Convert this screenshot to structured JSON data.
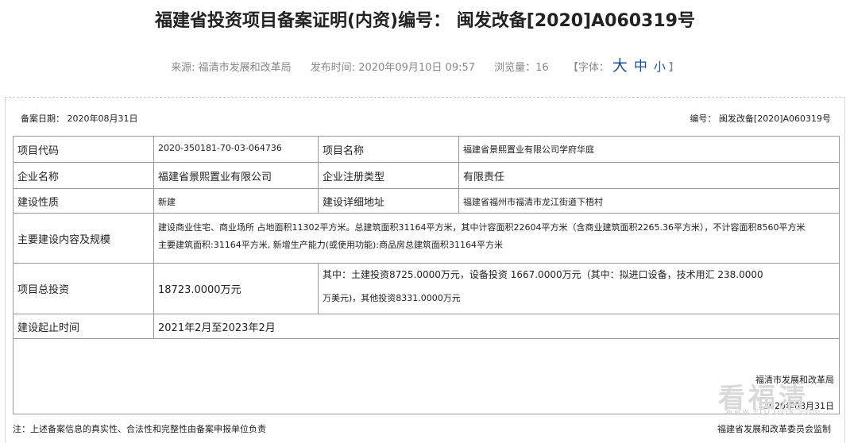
{
  "title": "福建省投资项目备案证明(内资)编号： 闽发改备[2020]A060319号",
  "meta": {
    "source": "来源: 福清市发展和改革局",
    "published": "发布时间: 2020年09月10日 09:57",
    "views": "浏览量：16",
    "font_switch_label": "【字体：",
    "font_big": "大",
    "font_mid": "中",
    "font_small": "小",
    "font_switch_end": "】"
  },
  "record": {
    "date": "备案日期： 2020年08月31日",
    "number": "编号： 闽发改备[2020]A060319号"
  },
  "rows": {
    "code_label": "项目代码",
    "code_value": "2020-350181-70-03-064736",
    "name_label": "项目名称",
    "name_value": "福建省景熙置业有限公司学府华庭",
    "company_label": "企业名称",
    "company_value": "福建省景熙置业有限公司",
    "type_label": "企业注册类型",
    "type_value": "有限责任",
    "nature_label": "建设性质",
    "nature_value": "新建",
    "address_label": "建设详细地址",
    "address_value": "福建省福州市福清市龙江街道下梧村",
    "scope_label": "主要建设内容及规模",
    "scope_line1": "建设商业住宅、商业场所 占地面积11302平方米。总建筑面积31164平方米，其中计容面积22604平方米（含商业建筑面积2265.36平方米），不计容面积8560平方米",
    "scope_line2": "主要建筑面积:31164平方米, 新增生产能力(或使用功能):商品房总建筑面积31164平方米",
    "investment_label": "项目总投资",
    "investment_value": "18723.0000万元",
    "investment_detail1": "其中：土建投资8725.0000万元，设备投资 1667.0000万元（其中：拟进口设备，技术用汇 238.0000",
    "investment_detail2": "万美元)，其他投资8331.0000万元",
    "period_label": "建设起止时间",
    "period_value": "2021年2月至2023年2月"
  },
  "footer": {
    "issuer": "福清市发展和改革局",
    "issue_date": "2020年08月31日",
    "note": "注：上述备案信息的真实性、合法性和完整性由备案申报单位负责",
    "monitor": "福建省发展和改革委员会监制",
    "watermark": "看福清",
    "watermark_url": "www.FQLOOK.com"
  }
}
